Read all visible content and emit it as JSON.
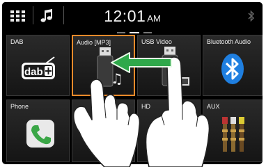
{
  "statusbar": {
    "time": "12:01",
    "ampm": "AM",
    "icons": [
      "grid-menu-icon",
      "music-note-icon",
      "bluetooth-status-icon"
    ]
  },
  "tiles": [
    {
      "label": "DAB",
      "icon": "dab-radio-icon"
    },
    {
      "label": "Audio [MP3]",
      "icon": "usb-audio-icon",
      "selected": true
    },
    {
      "label": "USB Video",
      "icon": "usb-video-icon"
    },
    {
      "label": "Bluetooth Audio",
      "icon": "bluetooth-icon"
    },
    {
      "label": "Phone",
      "icon": "phone-icon"
    },
    {
      "label": "HD",
      "icon": "hdmi-icon"
    },
    {
      "label": "AUX",
      "icon": "rca-cable-icon"
    }
  ],
  "gesture": {
    "type": "swipe-left",
    "icon": "swipe-arrow-icon"
  },
  "colors": {
    "selection": "#f08a2a",
    "gesture_arrow": "#2fa84a",
    "phone": "#3aa646",
    "bluetooth": "#1f7fe0"
  }
}
